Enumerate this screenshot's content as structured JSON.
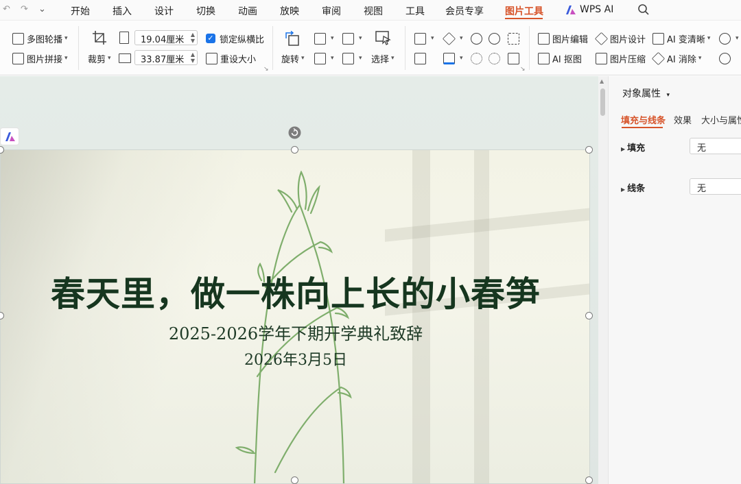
{
  "menubar": {
    "quick_access": [
      "↶",
      "↷",
      "⌄"
    ],
    "tabs": [
      {
        "label": "开始",
        "active": false
      },
      {
        "label": "插入",
        "active": false
      },
      {
        "label": "设计",
        "active": false
      },
      {
        "label": "切换",
        "active": false
      },
      {
        "label": "动画",
        "active": false
      },
      {
        "label": "放映",
        "active": false
      },
      {
        "label": "审阅",
        "active": false
      },
      {
        "label": "视图",
        "active": false
      },
      {
        "label": "工具",
        "active": false
      },
      {
        "label": "会员专享",
        "active": false
      },
      {
        "label": "图片工具",
        "active": true
      }
    ],
    "wps_ai_label": "WPS AI",
    "accent_color": "#d7542a"
  },
  "ribbon": {
    "carousel": "多图轮播",
    "stitch": "图片拼接",
    "crop": "裁剪",
    "height_value": "19.04厘米",
    "width_value": "33.87厘米",
    "lock_ratio": "锁定纵横比",
    "lock_ratio_checked": true,
    "reset_size": "重设大小",
    "rotate": "旋转",
    "select": "选择",
    "edit_image": "图片编辑",
    "design_image": "图片设计",
    "ai_sharpen": "AI 变清晰",
    "ai_cutout": "AI 抠图",
    "compress_image": "图片压缩",
    "ai_remove": "AI 消除"
  },
  "slide": {
    "title": "春天里，做一株向上长的小春笋",
    "subtitle": "2025-2026学年下期开学典礼致辞",
    "date": "2026年3月5日",
    "text_color": "#16361f",
    "sprout_color": "#7fae6c"
  },
  "panel": {
    "title": "对象属性",
    "tabs": [
      {
        "label": "填充与线条",
        "active": true
      },
      {
        "label": "效果",
        "active": false
      },
      {
        "label": "大小与属性",
        "active": false
      }
    ],
    "fill_label": "填充",
    "fill_value": "无",
    "line_label": "线条",
    "line_value": "无"
  }
}
